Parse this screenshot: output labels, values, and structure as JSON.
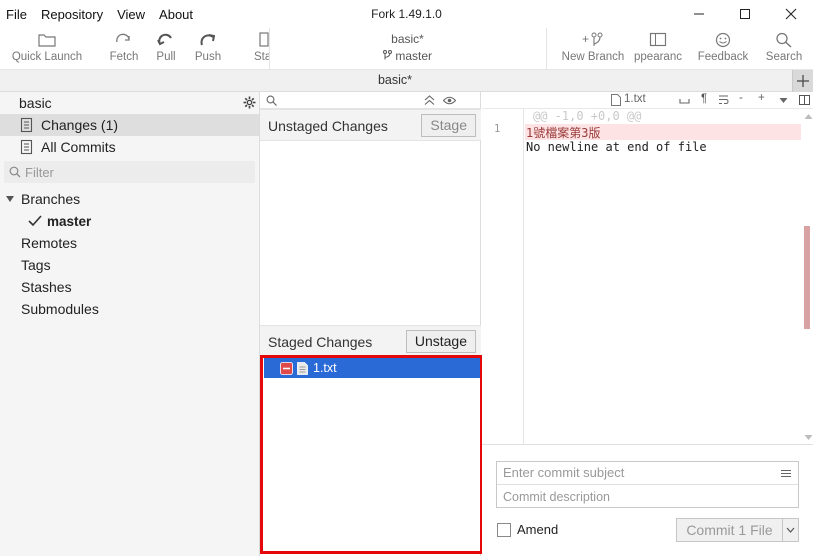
{
  "menu": [
    "File",
    "Repository",
    "View",
    "About"
  ],
  "window": {
    "title": "Fork 1.49.1.0"
  },
  "toolbar": {
    "quick_launch": "Quick Launch",
    "fetch": "Fetch",
    "pull": "Pull",
    "push": "Push",
    "stash": "Sta",
    "repo": "basic*",
    "branch": "master",
    "new_branch": "New Branch",
    "appearance": "ppearanc",
    "feedback": "Feedback",
    "search": "Search"
  },
  "tab": {
    "title": "basic*"
  },
  "sidebar": {
    "repo_name": "basic",
    "changes": "Changes (1)",
    "all_commits": "All Commits",
    "filter_placeholder": "Filter",
    "branches": "Branches",
    "current_branch": "master",
    "remotes": "Remotes",
    "tags": "Tags",
    "stashes": "Stashes",
    "submodules": "Submodules"
  },
  "changes": {
    "unstaged_title": "Unstaged Changes",
    "stage_button": "Stage",
    "staged_title": "Staged Changes",
    "unstage_button": "Unstage",
    "staged_files": [
      "1.txt"
    ]
  },
  "diff": {
    "file_name": "1.txt",
    "hunk_header": "@@ -1,0 +0,0 @@",
    "line_number": "1",
    "removed_line": "1號檔案第3版",
    "no_newline": "No newline at end of file"
  },
  "commit": {
    "subject_placeholder": "Enter commit subject",
    "description_placeholder": "Commit description",
    "amend_label": "Amend",
    "commit_button": "Commit 1 File"
  },
  "colors": {
    "selection": "#2a6ad6",
    "removed_bg": "#fde3e3",
    "highlight_border": "#e4080a"
  }
}
